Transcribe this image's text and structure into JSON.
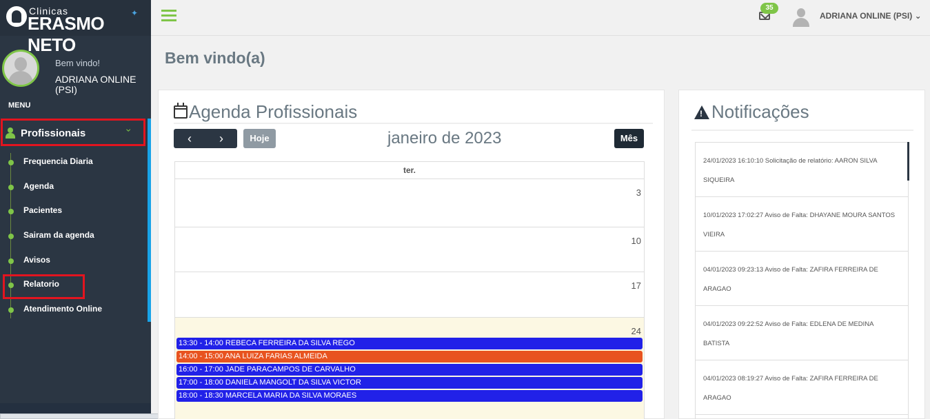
{
  "brand": {
    "small": "Clinicas",
    "big": "ERASMO NETO"
  },
  "user": {
    "welcome": "Bem vindo!",
    "name": "ADRIANA ONLINE (PSI)"
  },
  "menu": {
    "title": "MENU",
    "section": "Profissionais",
    "items": [
      {
        "label": "Frequencia Diaria"
      },
      {
        "label": "Agenda"
      },
      {
        "label": "Pacientes"
      },
      {
        "label": "Sairam da agenda"
      },
      {
        "label": "Avisos"
      },
      {
        "label": "Relatorio"
      },
      {
        "label": "Atendimento Online"
      }
    ]
  },
  "header": {
    "badge_count": "35",
    "user_label": "ADRIANA ONLINE (PSI)"
  },
  "page_title": "Bem vindo(a)",
  "agenda": {
    "title": "Agenda Profissionais",
    "prev_label": "‹",
    "next_label": "›",
    "today_label": "Hoje",
    "month_label": "janeiro de 2023",
    "view_label": "Mês",
    "day_header": "ter.",
    "weeks": [
      {
        "day": "3"
      },
      {
        "day": "10"
      },
      {
        "day": "17"
      },
      {
        "day": "24"
      }
    ],
    "events": [
      {
        "text": "13:30 - 14:00 REBECA FERREIRA DA SILVA REGO",
        "color": "#2121e8"
      },
      {
        "text": "14:00 - 15:00 ANA LUIZA FARIAS ALMEIDA",
        "color": "#e8531f"
      },
      {
        "text": "16:00 - 17:00 JADE PARACAMPOS DE CARVALHO",
        "color": "#2121e8"
      },
      {
        "text": "17:00 - 18:00 DANIELA MANGOLT DA SILVA VICTOR",
        "color": "#2121e8"
      },
      {
        "text": "18:00 - 18:30 MARCELA MARIA DA SILVA MORAES",
        "color": "#2121e8"
      }
    ]
  },
  "notifications": {
    "title": "Notificações",
    "items": [
      {
        "text": "24/01/2023 16:10:10 Solicitação de relatório: AARON SILVA SIQUEIRA"
      },
      {
        "text": "10/01/2023 17:02:27 Aviso de Falta: DHAYANE MOURA SANTOS VIEIRA"
      },
      {
        "text": "04/01/2023 09:23:13 Aviso de Falta: ZAFIRA FERREIRA DE ARAGAO"
      },
      {
        "text": "04/01/2023 09:22:52 Aviso de Falta: EDLENA DE MEDINA BATISTA"
      },
      {
        "text": "04/01/2023 08:19:27 Aviso de Falta: ZAFIRA FERREIRA DE ARAGAO"
      }
    ]
  },
  "colors": {
    "accent": "#7fc548",
    "sidebar": "#2b3643",
    "highlight": "#e3141f",
    "today_bg": "#fcf8e3"
  }
}
